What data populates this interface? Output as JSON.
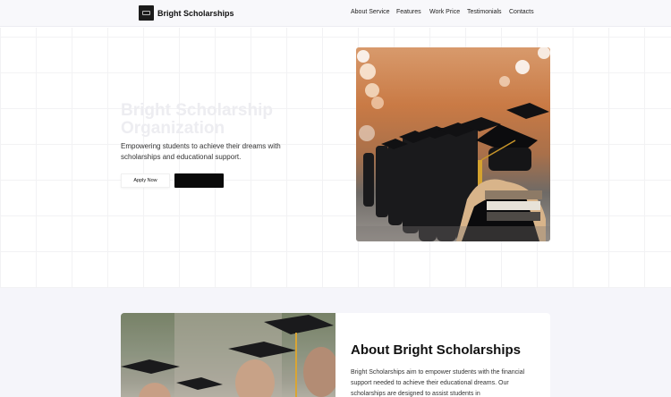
{
  "brand": {
    "name": "Bright Scholarships"
  },
  "nav": {
    "links": [
      {
        "label": "About Service"
      },
      {
        "label": "Features"
      },
      {
        "label": "Work Price"
      },
      {
        "label": "Testimonials"
      },
      {
        "label": "Contacts"
      }
    ]
  },
  "hero": {
    "title": "Bright Scholarship Organization",
    "subtitle": "Empowering students to achieve their dreams with scholarships and educational support.",
    "apply_label": "Apply Now",
    "secondary_label": ""
  },
  "about": {
    "title": "About Bright Scholarships",
    "text": "Bright Scholarships aim to empower students with the financial support needed to achieve their educational dreams. Our scholarships are designed to assist students in"
  },
  "colors": {
    "accent_dark": "#0a0a0a",
    "section_bg": "#f5f5fa",
    "navbar_bg": "#f8f8fb"
  }
}
